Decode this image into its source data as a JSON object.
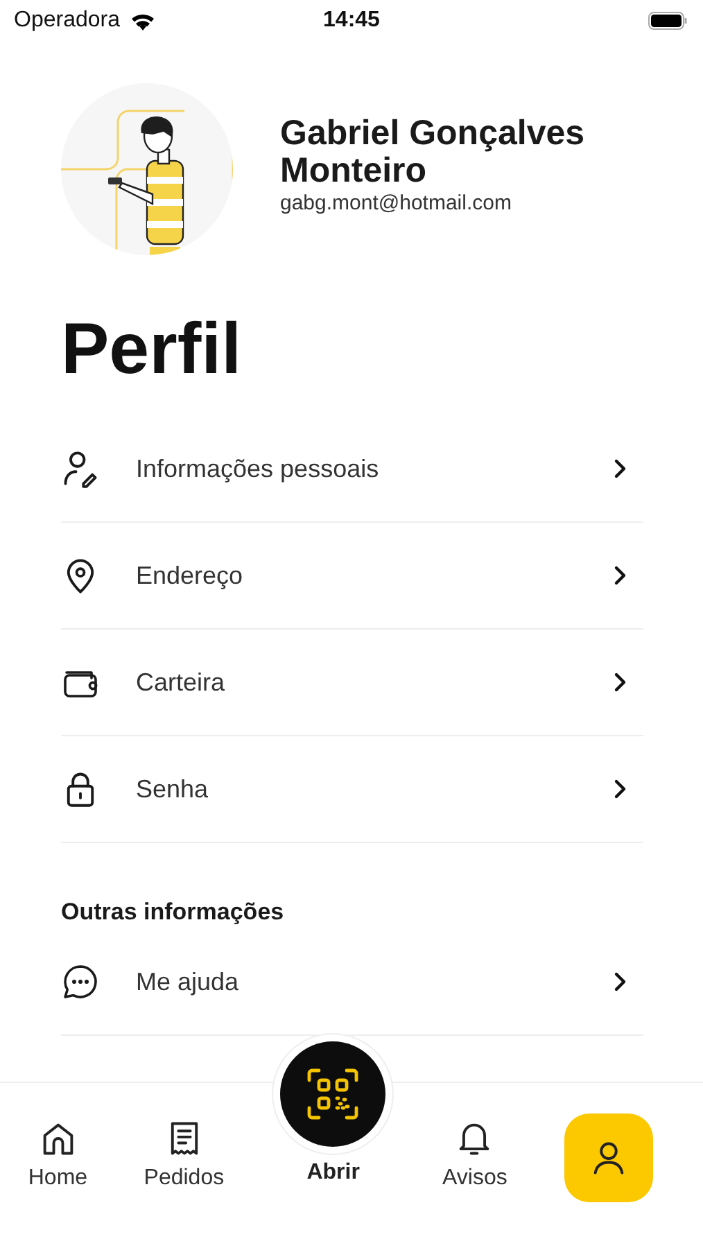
{
  "status_bar": {
    "carrier": "Operadora",
    "time": "14:45"
  },
  "profile": {
    "name": "Gabriel Gonçalves Monteiro",
    "email": "gabg.mont@hotmail.com"
  },
  "title": "Perfil",
  "sections": [
    {
      "items": [
        {
          "label": "Informações pessoais"
        },
        {
          "label": "Endereço"
        },
        {
          "label": "Carteira"
        },
        {
          "label": "Senha"
        }
      ]
    },
    {
      "heading": "Outras informações",
      "items": [
        {
          "label": "Me ajuda"
        }
      ]
    }
  ],
  "tab_bar": [
    {
      "kind": "plain",
      "label": "Home",
      "selected": false
    },
    {
      "kind": "plain",
      "label": "Pedidos",
      "selected": false
    },
    {
      "kind": "center",
      "label": "Abrir",
      "selected": false
    },
    {
      "kind": "plain",
      "label": "Avisos",
      "selected": false
    },
    {
      "kind": "plain",
      "selected": true
    }
  ]
}
